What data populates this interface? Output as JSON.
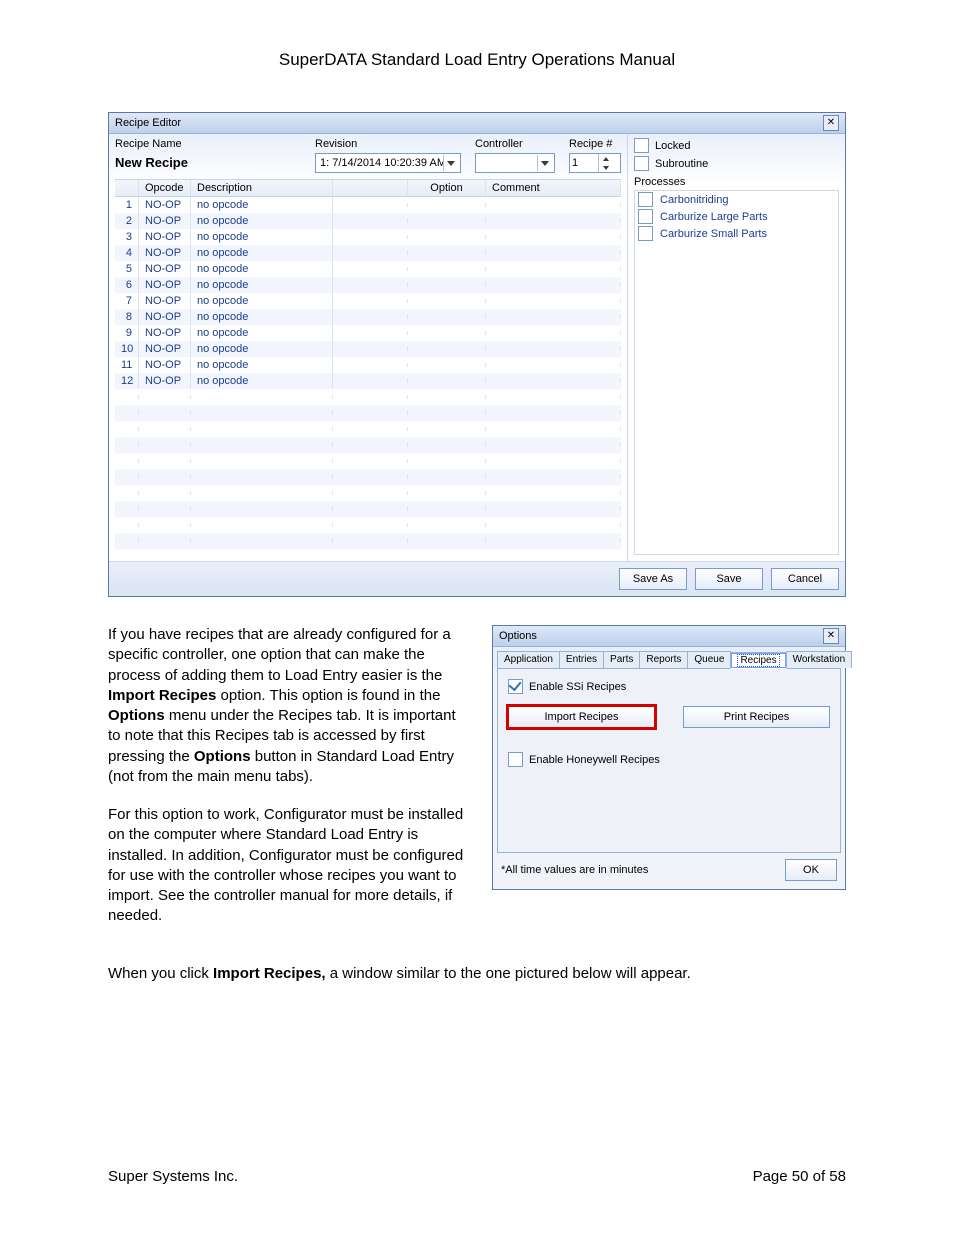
{
  "doc_header": "SuperDATA Standard Load Entry Operations Manual",
  "footer_left": "Super Systems Inc.",
  "footer_right": "Page 50 of 58",
  "recipe_editor": {
    "title": "Recipe Editor",
    "labels": {
      "recipe_name": "Recipe Name",
      "revision": "Revision",
      "controller": "Controller",
      "recipe_num": "Recipe #",
      "locked": "Locked",
      "subroutine": "Subroutine",
      "processes": "Processes"
    },
    "recipe_name_value": "New Recipe",
    "revision_value": "1: 7/14/2014 10:20:39 AM",
    "controller_value": "",
    "recipe_num_value": "1",
    "locked_checked": false,
    "subroutine_checked": false,
    "grid_headers": {
      "opcode": "Opcode",
      "description": "Description",
      "option": "Option",
      "comment": "Comment"
    },
    "rows": [
      {
        "n": "1",
        "opcode": "NO-OP",
        "desc": "no opcode"
      },
      {
        "n": "2",
        "opcode": "NO-OP",
        "desc": "no opcode"
      },
      {
        "n": "3",
        "opcode": "NO-OP",
        "desc": "no opcode"
      },
      {
        "n": "4",
        "opcode": "NO-OP",
        "desc": "no opcode"
      },
      {
        "n": "5",
        "opcode": "NO-OP",
        "desc": "no opcode"
      },
      {
        "n": "6",
        "opcode": "NO-OP",
        "desc": "no opcode"
      },
      {
        "n": "7",
        "opcode": "NO-OP",
        "desc": "no opcode"
      },
      {
        "n": "8",
        "opcode": "NO-OP",
        "desc": "no opcode"
      },
      {
        "n": "9",
        "opcode": "NO-OP",
        "desc": "no opcode"
      },
      {
        "n": "10",
        "opcode": "NO-OP",
        "desc": "no opcode"
      },
      {
        "n": "11",
        "opcode": "NO-OP",
        "desc": "no opcode"
      },
      {
        "n": "12",
        "opcode": "NO-OP",
        "desc": "no opcode"
      }
    ],
    "processes": [
      "Carbonitriding",
      "Carburize Large Parts",
      "Carburize Small Parts"
    ],
    "buttons": {
      "save_as": "Save As",
      "save": "Save",
      "cancel": "Cancel"
    }
  },
  "paragraphs": {
    "p1_a": "If you have recipes that are already configured for a specific controller, one option that can make the process of adding them to Load Entry easier is the ",
    "p1_b": "Import Recipes",
    "p1_c": " option. This option is found in the ",
    "p1_d": "Options",
    "p1_e": " menu under the Recipes tab. It is important to note that this Recipes tab is accessed by first pressing the ",
    "p1_f": "Options",
    "p1_g": " button in Standard Load Entry (not from the main menu tabs).",
    "p2": "For this option to work, Configurator must be installed on the computer where Standard Load Entry is installed. In addition, Configurator must be configured for use with the controller whose recipes you want to import. See the controller manual for more details, if needed.",
    "p3_a": "When you click ",
    "p3_b": "Import Recipes,",
    "p3_c": " a window similar to the one pictured below will appear."
  },
  "options_dialog": {
    "title": "Options",
    "tabs": [
      "Application",
      "Entries",
      "Parts",
      "Reports",
      "Queue",
      "Recipes",
      "Workstation"
    ],
    "selected_tab": 5,
    "enable_ssi": "Enable SSi Recipes",
    "enable_ssi_checked": true,
    "import_btn": "Import Recipes",
    "print_btn": "Print Recipes",
    "enable_honeywell": "Enable Honeywell Recipes",
    "enable_honeywell_checked": false,
    "note": "*All time values are in minutes",
    "ok": "OK"
  }
}
